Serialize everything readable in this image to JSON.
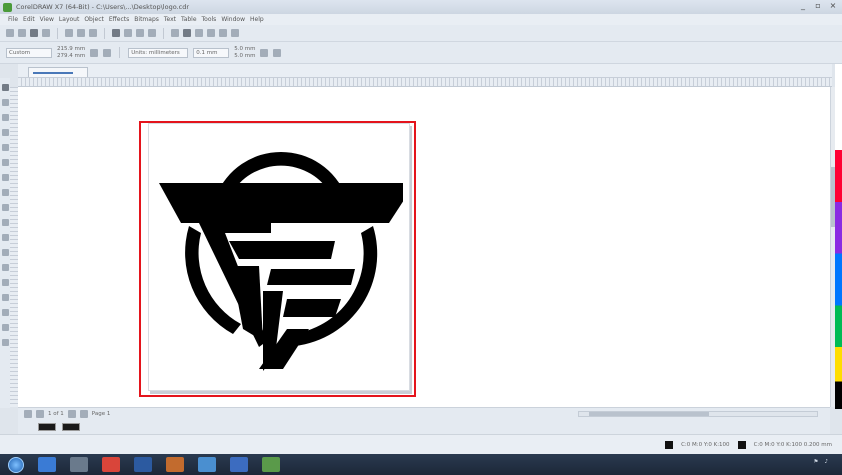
{
  "window": {
    "title": "CorelDRAW X7 (64-Bit) - C:\\Users\\...\\Desktop\\logo.cdr",
    "controls": [
      "_",
      "▫",
      "×"
    ]
  },
  "menu": [
    "File",
    "Edit",
    "View",
    "Layout",
    "Object",
    "Effects",
    "Bitmaps",
    "Text",
    "Table",
    "Tools",
    "Window",
    "Help"
  ],
  "property_bar": {
    "paper_preset": "Custom",
    "width": "215.9 mm",
    "height": "279.4 mm",
    "units_label": "Units: millimeters",
    "nudge": "0.1 mm",
    "duplicate_x": "5.0 mm",
    "duplicate_y": "5.0 mm"
  },
  "page_nav": {
    "page_label": "Page 1",
    "counter": "1 of 1"
  },
  "status_bar": {
    "left": "",
    "fill_label": "C:0 M:0 Y:0 K:100",
    "outline_label": "C:0 M:0 Y:0 K:100 0.200 mm"
  },
  "taskbar": {
    "time": "",
    "date": ""
  },
  "colors": {
    "selection_border": "#e4141c",
    "logo_fill": "#000000"
  },
  "icons": {
    "start": "windows-start-orb",
    "tray_flag": "flag-icon",
    "tray_volume": "volume-icon"
  }
}
